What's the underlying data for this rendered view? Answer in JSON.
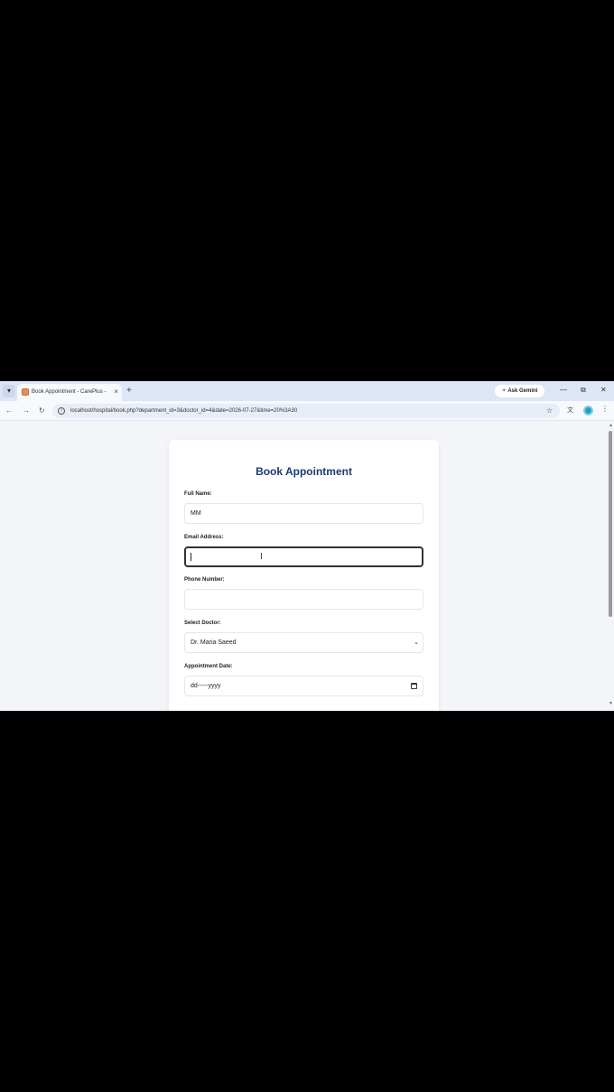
{
  "browser": {
    "tab_title": "Book Appointment - CarePlus -",
    "tab_close": "×",
    "new_tab": "+",
    "tab_menu": "▾",
    "gemini_label": "Ask Gemini",
    "gemini_glyph": "✦",
    "window_controls": {
      "minimize": "—",
      "restore": "⧉",
      "close": "✕"
    },
    "url": "localhost/hospital/book.php?department_id=3&doctor_id=4&date=2026-07-27&time=20%3A30",
    "nav": {
      "back": "←",
      "forward": "→",
      "reload": "↻"
    },
    "star": "☆",
    "menu": "⋮"
  },
  "form": {
    "title": "Book Appointment",
    "full_name": {
      "label": "Full Name:",
      "value": "MM"
    },
    "email": {
      "label": "Email Address:",
      "value": ""
    },
    "phone": {
      "label": "Phone Number:",
      "value": ""
    },
    "doctor": {
      "label": "Select Doctor:",
      "selected": "Dr. Maria Saeed"
    },
    "date": {
      "label": "Appointment Date:",
      "placeholder": "dd-----yyyy"
    }
  },
  "icons": {
    "info": "info-icon",
    "calendar": "calendar-icon",
    "chevron": "chevron-down-icon"
  },
  "colors": {
    "title": "#1e3a6e",
    "tabstrip": "#dde6f6",
    "profile": "#2a9bc4",
    "favicon": "#e48e5c"
  }
}
